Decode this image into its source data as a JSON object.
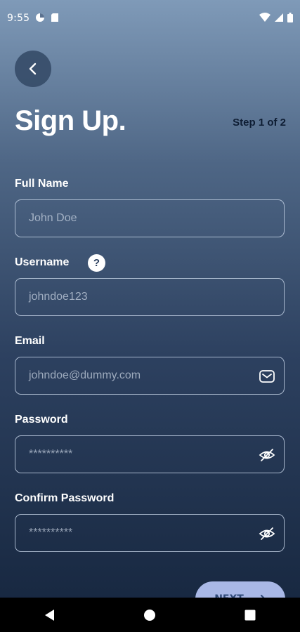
{
  "status_bar": {
    "time": "9:55",
    "left_icons": [
      "data-saver-icon",
      "sd-card-icon"
    ],
    "right_icons": [
      "wifi-icon",
      "signal-icon",
      "battery-icon"
    ]
  },
  "header": {
    "title": "Sign Up.",
    "step": "Step 1 of 2"
  },
  "form": {
    "full_name": {
      "label": "Full Name",
      "placeholder": "John Doe"
    },
    "username": {
      "label": "Username",
      "placeholder": "johndoe123",
      "help": "?"
    },
    "email": {
      "label": "Email",
      "placeholder": "johndoe@dummy.com"
    },
    "password": {
      "label": "Password",
      "placeholder": "**********"
    },
    "confirm_password": {
      "label": "Confirm Password",
      "placeholder": "**********"
    }
  },
  "actions": {
    "next_label": "NEXT",
    "next_icon": "arrow-right-icon"
  },
  "colors": {
    "gradient_top": "#7f9ab8",
    "gradient_bottom": "#15253d",
    "next_button": "#a9b8e6"
  }
}
